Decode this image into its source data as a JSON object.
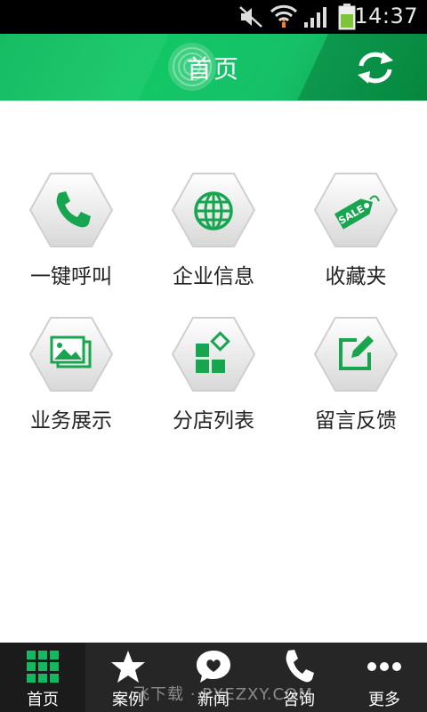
{
  "status_bar": {
    "time": "14:37"
  },
  "header": {
    "title": "首页"
  },
  "grid": {
    "items": [
      {
        "label": "一键呼叫",
        "icon": "phone-icon"
      },
      {
        "label": "企业信息",
        "icon": "globe-icon"
      },
      {
        "label": "收藏夹",
        "icon": "sale-tag-icon"
      },
      {
        "label": "业务展示",
        "icon": "photos-icon"
      },
      {
        "label": "分店列表",
        "icon": "category-blocks-icon"
      },
      {
        "label": "留言反馈",
        "icon": "edit-icon"
      }
    ]
  },
  "bottom_nav": {
    "items": [
      {
        "label": "首页",
        "icon": "grid-icon",
        "active": true
      },
      {
        "label": "案例",
        "icon": "star-icon"
      },
      {
        "label": "新闻",
        "icon": "chat-heart-icon"
      },
      {
        "label": "咨询",
        "icon": "phone-icon"
      },
      {
        "label": "更多",
        "icon": "more-icon"
      }
    ]
  },
  "watermark": "飞下载 · PXEZXY.COM",
  "colors": {
    "accent": "#0fb95d",
    "nav_bg": "#262626",
    "header_green": "#12c765"
  }
}
